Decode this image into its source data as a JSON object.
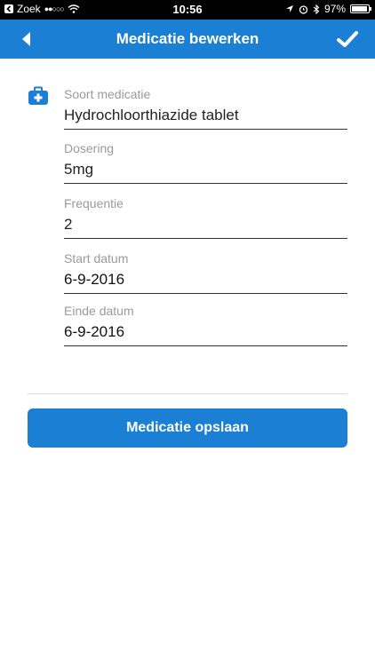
{
  "status_bar": {
    "carrier": "Zoek",
    "signal": "●●○○○",
    "time": "10:56",
    "battery": "97%",
    "battery_level": 0.97
  },
  "nav": {
    "title": "Medicatie bewerken"
  },
  "form": {
    "fields": [
      {
        "label": "Soort medicatie",
        "value": "Hydrochloorthiazide tablet"
      },
      {
        "label": "Dosering",
        "value": "5mg"
      },
      {
        "label": "Frequentie",
        "value": "2"
      },
      {
        "label": "Start datum",
        "value": "6-9-2016"
      },
      {
        "label": "Einde datum",
        "value": "6-9-2016"
      }
    ],
    "save_label": "Medicatie opslaan"
  },
  "colors": {
    "accent": "#1b7fd3",
    "status_bar": "#000000"
  }
}
